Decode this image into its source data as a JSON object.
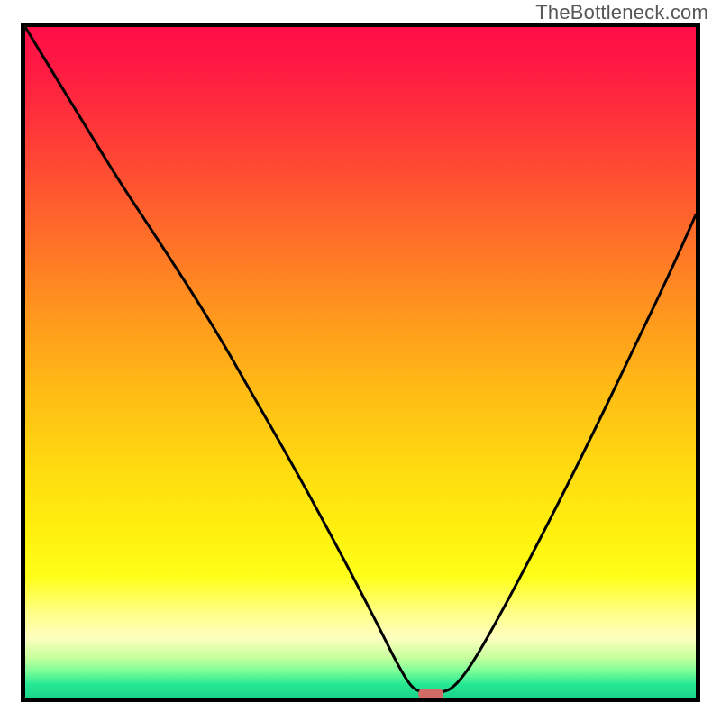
{
  "watermark": "TheBottleneck.com",
  "colors": {
    "frame": "#000000",
    "curve": "#000000",
    "marker": "#cf6a65",
    "gradient_top": "#ff0d47",
    "gradient_bottom": "#19d58b"
  },
  "chart_data": {
    "type": "line",
    "title": "",
    "xlabel": "",
    "ylabel": "",
    "xlim": [
      0,
      1
    ],
    "ylim": [
      0,
      1
    ],
    "x": [
      0.0,
      0.07,
      0.14,
      0.2,
      0.28,
      0.34,
      0.4,
      0.46,
      0.52,
      0.565,
      0.585,
      0.62,
      0.64,
      0.67,
      0.72,
      0.78,
      0.84,
      0.9,
      0.96,
      1.0
    ],
    "y": [
      1.0,
      0.885,
      0.77,
      0.68,
      0.555,
      0.45,
      0.345,
      0.235,
      0.12,
      0.03,
      0.007,
      0.007,
      0.015,
      0.055,
      0.145,
      0.26,
      0.38,
      0.505,
      0.63,
      0.72
    ],
    "optimal_x": 0.605,
    "optimal_y": 0.006
  }
}
